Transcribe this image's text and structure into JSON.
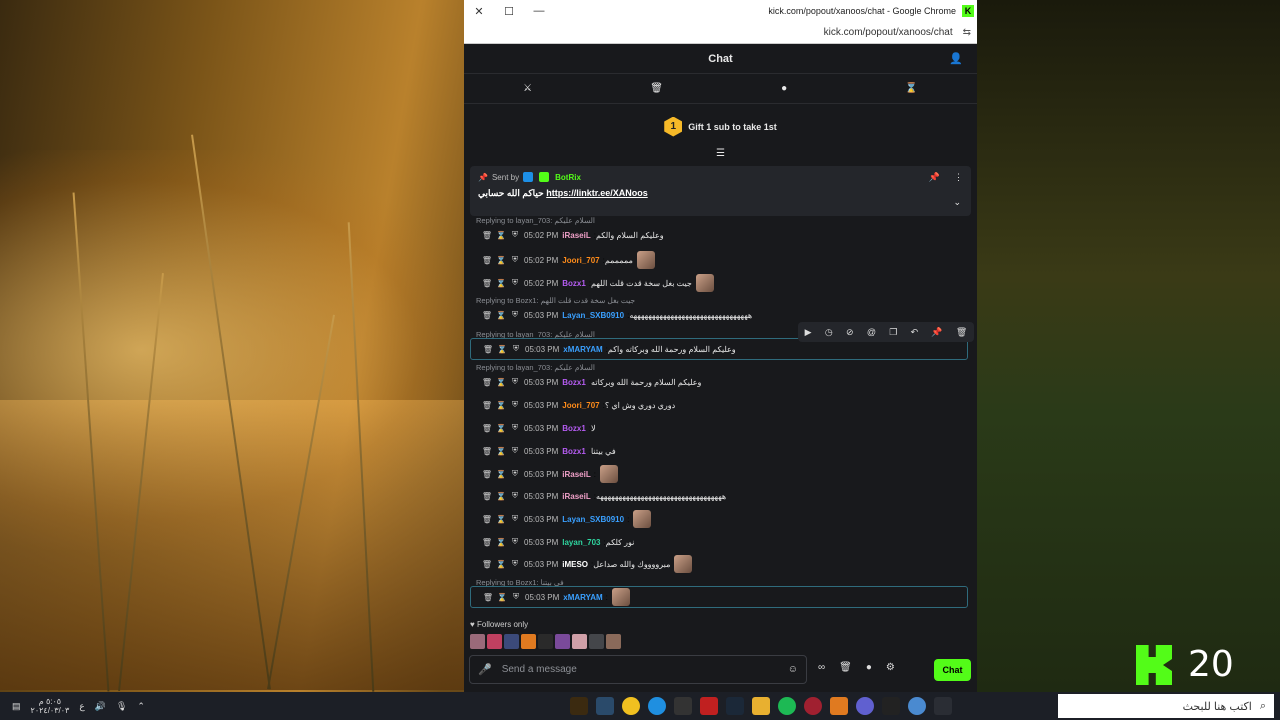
{
  "browser": {
    "window_title": "kick.com/popout/xanoos/chat - Google Chrome",
    "url": "kick.com/popout/xanoos/chat"
  },
  "chat": {
    "title": "Chat",
    "gift": {
      "rank": "1",
      "label": "Gift 1 sub to take 1st"
    },
    "pinned": {
      "sent_by": "Sent by",
      "sender": "BotRix",
      "text": "حياكم الله حسابي",
      "link": "https://linktr.ee/XANoos"
    },
    "messages": [
      {
        "reply": "Replying to layan_703: السلام عليكم",
        "time": "05:02 PM",
        "user": "iRaseiL",
        "color": "#f0a0c8",
        "text": "وعليكم السلام والكم",
        "emote": false
      },
      {
        "reply": "",
        "time": "05:02 PM",
        "user": "Joori_707",
        "color": "#ff8c1a",
        "text": "مممممم",
        "emote": true
      },
      {
        "reply": "",
        "time": "05:02 PM",
        "user": "Bozx1",
        "color": "#b45cf0",
        "text": "جيت بغل سخة قدت قلت اللهم",
        "emote": true
      },
      {
        "reply": "Replying to Bozx1: جيت بغل سخة قدت قلت اللهم",
        "time": "05:03 PM",
        "user": "Layan_SXB0910",
        "color": "#3aa0ff",
        "text": "ههههههههههههههههههههههههههههههههه",
        "emote": false
      },
      {
        "reply": "Replying to layan_703: السلام عليكم",
        "time": "05:03 PM",
        "user": "xMARYAM",
        "color": "#3aa0ff",
        "text": "وعليكم السلام ورحمة الله وبركاته واكم",
        "emote": false
      },
      {
        "reply": "Replying to layan_703: السلام عليكم",
        "time": "05:03 PM",
        "user": "Bozx1",
        "color": "#b45cf0",
        "text": "وعليكم السلام ورحمة الله وبركاته",
        "emote": false
      },
      {
        "reply": "",
        "time": "05:03 PM",
        "user": "Joori_707",
        "color": "#ff8c1a",
        "text": "دوري دوري وش اي ؟",
        "emote": false
      },
      {
        "reply": "",
        "time": "05:03 PM",
        "user": "Bozx1",
        "color": "#b45cf0",
        "text": "لا",
        "emote": false
      },
      {
        "reply": "",
        "time": "05:03 PM",
        "user": "Bozx1",
        "color": "#b45cf0",
        "text": "في بيتنا",
        "emote": false
      },
      {
        "reply": "",
        "time": "05:03 PM",
        "user": "iRaseiL",
        "color": "#f0a0c8",
        "text": "",
        "emote": true
      },
      {
        "reply": "",
        "time": "05:03 PM",
        "user": "iRaseiL",
        "color": "#f0a0c8",
        "text": "ههههههههههههههههههههههههههههههههههه",
        "emote": false
      },
      {
        "reply": "",
        "time": "05:03 PM",
        "user": "Layan_SXB0910",
        "color": "#3aa0ff",
        "text": "",
        "emote": true
      },
      {
        "reply": "",
        "time": "05:03 PM",
        "user": "layan_703",
        "color": "#2fd6a0",
        "text": "نور كلكم",
        "emote": false
      },
      {
        "reply": "",
        "time": "05:03 PM",
        "user": "iMESO",
        "color": "#ffffff",
        "text": "مبرووووك والله صداعل",
        "emote": true
      },
      {
        "reply": "Replying to Bozx1: في بيتنا",
        "time": "05:03 PM",
        "user": "xMARYAM",
        "color": "#3aa0ff",
        "text": "",
        "emote": true
      }
    ],
    "followers_only": "Followers only",
    "input_placeholder": "Send a message",
    "chat_button": "Chat"
  },
  "overlay": {
    "counter": "20"
  },
  "taskbar": {
    "search_placeholder": "اكتب هنا للبحث",
    "clock_time": "٥:٠٥ م",
    "clock_date": "٢٠٢٤/٠٣/٠٣",
    "lang": "ع"
  },
  "colors": {
    "kick_green": "#53fc18",
    "chat_bg": "#18191c"
  }
}
